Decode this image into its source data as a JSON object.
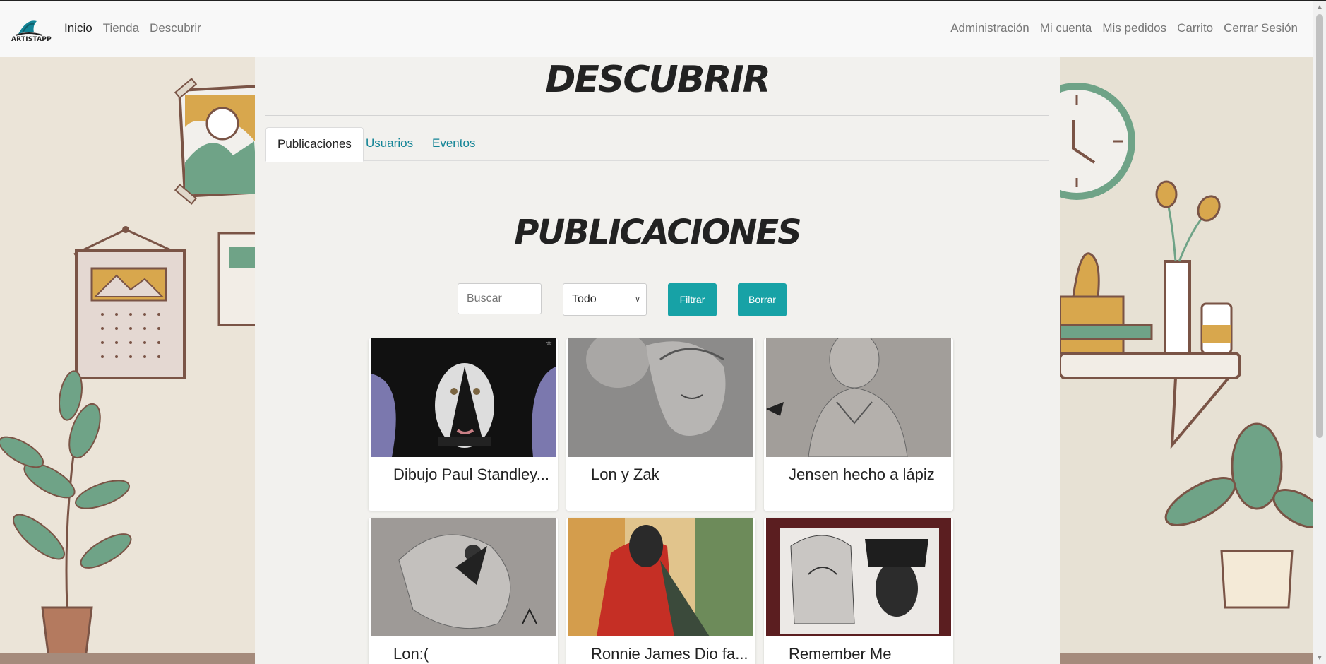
{
  "brand": {
    "name": "ARTISTAPP"
  },
  "nav": {
    "left": [
      "Inicio",
      "Tienda",
      "Descubrir"
    ],
    "right": [
      "Administración",
      "Mi cuenta",
      "Mis pedidos",
      "Carrito",
      "Cerrar Sesión"
    ]
  },
  "page": {
    "title": "DESCUBRIR"
  },
  "tabs": [
    "Publicaciones",
    "Usuarios",
    "Eventos"
  ],
  "section": {
    "title": "PUBLICACIONES"
  },
  "filters": {
    "search_placeholder": "Buscar",
    "select_value": "Todo",
    "filter_label": "Filtrar",
    "clear_label": "Borrar"
  },
  "posts": [
    {
      "title": "Dibujo Paul Standley..."
    },
    {
      "title": "Lon y Zak"
    },
    {
      "title": "Jensen hecho a lápiz"
    },
    {
      "title": "Lon:("
    },
    {
      "title": "Ronnie James Dio fa..."
    },
    {
      "title": "Remember Me"
    }
  ],
  "colors": {
    "accent": "#17a2a6",
    "link": "#138496",
    "deco_green": "#6fa387",
    "deco_brown": "#7a5446",
    "deco_mustard": "#d8a74d"
  }
}
